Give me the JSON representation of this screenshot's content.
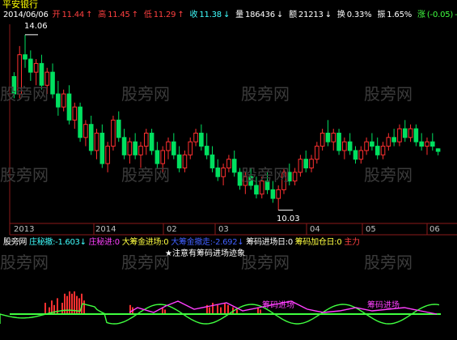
{
  "ticker_title": "平安银行",
  "header": {
    "date": "2014/06/06",
    "open_label": "开",
    "open": "11.44",
    "open_arrow": "↑",
    "high_label": "高",
    "high": "11.45",
    "high_arrow": "↑",
    "low_label": "低",
    "low": "11.29",
    "low_arrow": "↑",
    "close_label": "收",
    "close": "11.38",
    "close_arrow": "↓",
    "volume_label": "量",
    "volume": "186436",
    "volume_arrow": "↓",
    "amount_label": "额",
    "amount": "21213",
    "amount_arrow": "↓",
    "turnover_label": "换",
    "turnover": "0.33%",
    "amplitude_label": "振",
    "amplitude": "1.65%",
    "change_label": "涨",
    "change": "(-0.05)",
    "change_pct": "-0"
  },
  "price_annotations": {
    "high_mark": "14.06",
    "low_mark": "10.03"
  },
  "x_axis_labels": [
    "2013",
    "2014",
    "02",
    "03",
    "04",
    "05",
    "06"
  ],
  "indicator_bar": {
    "source": "股旁网",
    "zhuang_retreat_label": "庄秘撤:",
    "zhuang_retreat_value": "-1.603",
    "zhuang_retreat_arrow": "↓",
    "zhuang_enter_label": "庄秘进:",
    "zhuang_enter_value": "0",
    "big_in_label": "大筹金进场:",
    "big_in_value": "0",
    "big_out_label": "大筹金撤走:",
    "big_out_value": "-2.692",
    "big_out_arrow": "↓",
    "chip_day_label": "筹码进场日:",
    "chip_day_value": "0",
    "chip_add_label": "筹码加仓日:",
    "chip_add_value": "0",
    "main_force_label": "主力",
    "note": "★注意有筹码进场迹象"
  },
  "indicator_annotations": [
    "筹码进场",
    "筹码进场"
  ],
  "watermarks": [
    "股旁网",
    "股旁网",
    "股旁网",
    "股旁网",
    "股旁网",
    "股旁网",
    "股旁网",
    "股旁网",
    "股旁网",
    "股旁网",
    "股旁网",
    "股旁网"
  ],
  "colors": {
    "up": "#ff3030",
    "down": "#00e060",
    "flat": "#ffffff",
    "header_red": "#ff4040",
    "header_cyan": "#40ffff",
    "header_yellow": "#ffff40",
    "title": "#ffff00",
    "magenta": "#ff40ff",
    "green_line": "#40ff40"
  },
  "chart_data": {
    "type": "candlestick",
    "ylim": [
      9.8,
      14.3
    ],
    "candles": [
      [
        13.1,
        13.2,
        12.6,
        12.7
      ],
      [
        12.7,
        13.8,
        12.6,
        13.6
      ],
      [
        13.6,
        14.06,
        13.3,
        13.5
      ],
      [
        13.5,
        13.7,
        13.0,
        13.2
      ],
      [
        13.2,
        13.5,
        12.9,
        13.4
      ],
      [
        13.4,
        13.6,
        12.8,
        12.9
      ],
      [
        12.9,
        13.3,
        12.7,
        13.2
      ],
      [
        13.2,
        13.4,
        12.6,
        12.7
      ],
      [
        12.7,
        13.0,
        12.2,
        12.4
      ],
      [
        12.4,
        12.8,
        12.3,
        12.7
      ],
      [
        12.7,
        12.9,
        12.0,
        12.1
      ],
      [
        12.1,
        12.5,
        11.9,
        12.4
      ],
      [
        12.4,
        12.5,
        11.6,
        11.7
      ],
      [
        11.7,
        12.1,
        11.5,
        12.0
      ],
      [
        12.0,
        12.2,
        11.3,
        11.4
      ],
      [
        11.4,
        11.9,
        11.2,
        11.8
      ],
      [
        11.8,
        12.0,
        11.0,
        11.1
      ],
      [
        11.1,
        11.6,
        10.9,
        11.5
      ],
      [
        11.5,
        12.2,
        11.4,
        12.1
      ],
      [
        12.1,
        12.3,
        11.6,
        11.7
      ],
      [
        11.7,
        11.9,
        11.2,
        11.3
      ],
      [
        11.3,
        11.7,
        11.1,
        11.6
      ],
      [
        11.6,
        11.8,
        11.2,
        11.3
      ],
      [
        11.3,
        11.6,
        11.0,
        11.5
      ],
      [
        11.5,
        11.9,
        11.3,
        11.8
      ],
      [
        11.8,
        11.9,
        11.3,
        11.4
      ],
      [
        11.4,
        11.6,
        11.0,
        11.1
      ],
      [
        11.1,
        11.5,
        10.9,
        11.4
      ],
      [
        11.4,
        11.7,
        11.2,
        11.6
      ],
      [
        11.6,
        11.8,
        11.2,
        11.3
      ],
      [
        11.3,
        11.5,
        10.9,
        11.0
      ],
      [
        11.0,
        11.4,
        10.9,
        11.3
      ],
      [
        11.3,
        11.7,
        11.2,
        11.6
      ],
      [
        11.6,
        11.9,
        11.5,
        11.8
      ],
      [
        11.8,
        12.0,
        11.4,
        11.5
      ],
      [
        11.5,
        11.8,
        11.2,
        11.3
      ],
      [
        11.3,
        11.5,
        10.9,
        11.0
      ],
      [
        11.0,
        11.2,
        10.7,
        10.8
      ],
      [
        10.8,
        11.1,
        10.6,
        11.0
      ],
      [
        11.0,
        11.3,
        10.9,
        11.2
      ],
      [
        11.2,
        11.4,
        10.8,
        10.9
      ],
      [
        10.9,
        11.0,
        10.5,
        10.6
      ],
      [
        10.6,
        10.9,
        10.4,
        10.8
      ],
      [
        10.8,
        11.0,
        10.5,
        10.6
      ],
      [
        10.6,
        10.8,
        10.3,
        10.4
      ],
      [
        10.4,
        10.8,
        10.3,
        10.7
      ],
      [
        10.7,
        10.9,
        10.4,
        10.5
      ],
      [
        10.5,
        10.7,
        10.2,
        10.3
      ],
      [
        10.3,
        10.6,
        10.03,
        10.5
      ],
      [
        10.5,
        11.0,
        10.4,
        10.9
      ],
      [
        10.9,
        11.1,
        10.6,
        10.7
      ],
      [
        10.7,
        11.0,
        10.6,
        10.9
      ],
      [
        10.9,
        11.3,
        10.8,
        11.2
      ],
      [
        11.2,
        11.4,
        10.9,
        11.0
      ],
      [
        11.0,
        11.3,
        10.9,
        11.2
      ],
      [
        11.2,
        11.6,
        11.1,
        11.5
      ],
      [
        11.5,
        11.9,
        11.4,
        11.8
      ],
      [
        11.8,
        12.1,
        11.5,
        11.6
      ],
      [
        11.6,
        11.9,
        11.4,
        11.8
      ],
      [
        11.8,
        11.9,
        11.3,
        11.4
      ],
      [
        11.4,
        11.7,
        11.2,
        11.6
      ],
      [
        11.6,
        11.8,
        11.3,
        11.4
      ],
      [
        11.4,
        11.5,
        11.1,
        11.2
      ],
      [
        11.2,
        11.5,
        11.1,
        11.4
      ],
      [
        11.4,
        11.7,
        11.3,
        11.6
      ],
      [
        11.6,
        11.8,
        11.4,
        11.5
      ],
      [
        11.5,
        11.7,
        11.2,
        11.3
      ],
      [
        11.3,
        11.6,
        11.2,
        11.5
      ],
      [
        11.5,
        11.8,
        11.4,
        11.7
      ],
      [
        11.7,
        11.9,
        11.5,
        11.6
      ],
      [
        11.6,
        12.0,
        11.5,
        11.9
      ],
      [
        11.9,
        12.1,
        11.6,
        11.7
      ],
      [
        11.7,
        12.0,
        11.6,
        11.9
      ],
      [
        11.9,
        12.0,
        11.5,
        11.6
      ],
      [
        11.6,
        11.8,
        11.4,
        11.5
      ],
      [
        11.5,
        11.7,
        11.3,
        11.6
      ],
      [
        11.6,
        11.8,
        11.4,
        11.5
      ],
      [
        11.44,
        11.45,
        11.29,
        11.38
      ]
    ],
    "indicator_bars": [
      [
        55,
        0.5
      ],
      [
        60,
        0.3
      ],
      [
        63,
        0.6
      ],
      [
        66,
        0.4
      ],
      [
        70,
        0.7
      ],
      [
        76,
        0.5
      ],
      [
        79,
        0.9
      ],
      [
        82,
        0.8
      ],
      [
        85,
        1.0
      ],
      [
        88,
        0.9
      ],
      [
        91,
        1.0
      ],
      [
        94,
        0.8
      ],
      [
        97,
        0.7
      ],
      [
        100,
        0.9
      ],
      [
        103,
        0.6
      ],
      [
        160,
        0.4
      ],
      [
        163,
        0.3
      ],
      [
        200,
        0.3
      ],
      [
        203,
        0.2
      ],
      [
        255,
        0.4
      ],
      [
        258,
        0.3
      ],
      [
        262,
        0.5
      ],
      [
        268,
        0.4
      ],
      [
        272,
        0.3
      ],
      [
        277,
        0.5
      ],
      [
        281,
        0.4
      ],
      [
        287,
        0.3
      ],
      [
        292,
        0.2
      ],
      [
        318,
        0.3
      ],
      [
        321,
        0.2
      ]
    ]
  }
}
